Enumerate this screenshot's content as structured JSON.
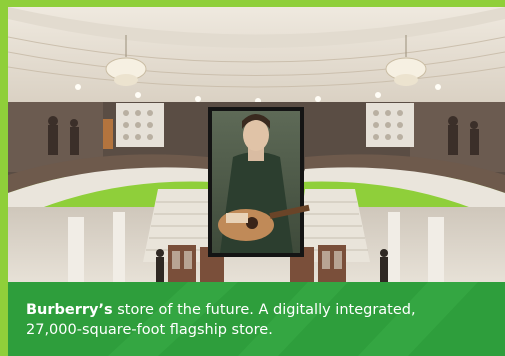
{
  "caption": {
    "brand": "Burberry’s",
    "line1_rest": " store of the future. A digitally integrated,",
    "line2": "27,000-square-foot flagship store."
  },
  "colors": {
    "frame_green": "#8fcf3a",
    "caption_green": "#2e9e3c",
    "caption_text": "#ffffff"
  },
  "photo": {
    "subject": "store-interior-with-large-screen",
    "screen_content": "person-playing-acoustic-guitar"
  }
}
